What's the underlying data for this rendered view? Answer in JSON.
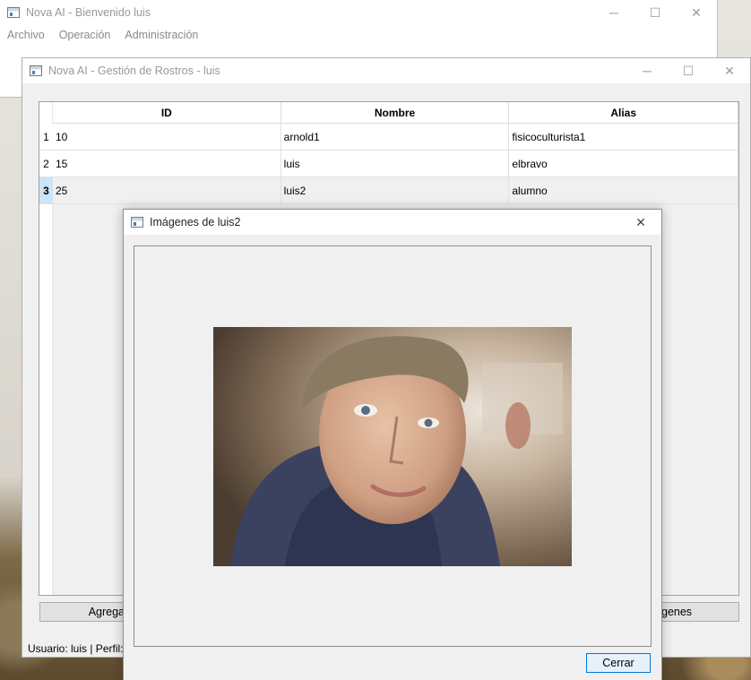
{
  "main_window": {
    "title": "Nova AI - Bienvenido luis",
    "menu": [
      "Archivo",
      "Operación",
      "Administración"
    ]
  },
  "faces_window": {
    "title": "Nova AI - Gestión de Rostros - luis",
    "table": {
      "columns": [
        "ID",
        "Nombre",
        "Alias"
      ],
      "rows": [
        {
          "num": "1",
          "id": "10",
          "nombre": "arnold1",
          "alias": "fisicoculturista1"
        },
        {
          "num": "2",
          "id": "15",
          "nombre": "luis",
          "alias": "elbravo"
        },
        {
          "num": "3",
          "id": "25",
          "nombre": "luis2",
          "alias": "alumno",
          "selected": true
        }
      ]
    },
    "add_button_partial": "Agrega",
    "images_button_partial": "genes",
    "status_partial": "Usuario: luis | Perfil:"
  },
  "images_dialog": {
    "title": "Imágenes de luis2",
    "photo_icon": "portrait-photo",
    "close_label": "Cerrar"
  },
  "icons": {
    "minimize": "─",
    "maximize": "☐",
    "close": "✕"
  }
}
